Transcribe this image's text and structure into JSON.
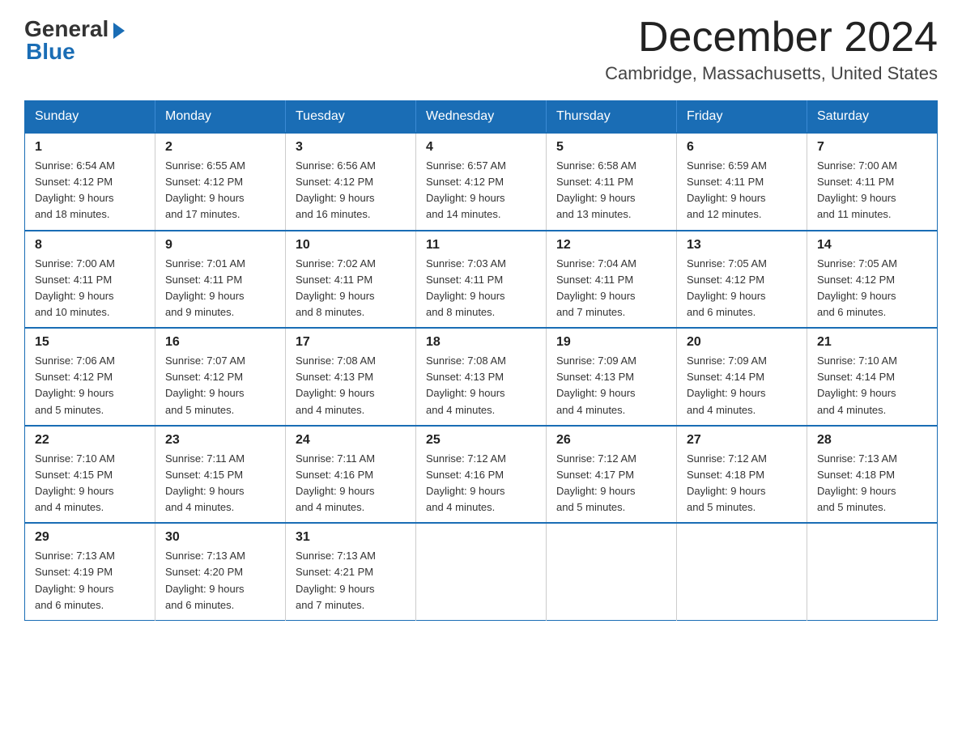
{
  "logo": {
    "general": "General",
    "blue": "Blue"
  },
  "header": {
    "month": "December 2024",
    "location": "Cambridge, Massachusetts, United States"
  },
  "weekdays": [
    "Sunday",
    "Monday",
    "Tuesday",
    "Wednesday",
    "Thursday",
    "Friday",
    "Saturday"
  ],
  "weeks": [
    [
      {
        "day": "1",
        "sunrise": "6:54 AM",
        "sunset": "4:12 PM",
        "daylight": "9 hours and 18 minutes."
      },
      {
        "day": "2",
        "sunrise": "6:55 AM",
        "sunset": "4:12 PM",
        "daylight": "9 hours and 17 minutes."
      },
      {
        "day": "3",
        "sunrise": "6:56 AM",
        "sunset": "4:12 PM",
        "daylight": "9 hours and 16 minutes."
      },
      {
        "day": "4",
        "sunrise": "6:57 AM",
        "sunset": "4:12 PM",
        "daylight": "9 hours and 14 minutes."
      },
      {
        "day": "5",
        "sunrise": "6:58 AM",
        "sunset": "4:11 PM",
        "daylight": "9 hours and 13 minutes."
      },
      {
        "day": "6",
        "sunrise": "6:59 AM",
        "sunset": "4:11 PM",
        "daylight": "9 hours and 12 minutes."
      },
      {
        "day": "7",
        "sunrise": "7:00 AM",
        "sunset": "4:11 PM",
        "daylight": "9 hours and 11 minutes."
      }
    ],
    [
      {
        "day": "8",
        "sunrise": "7:00 AM",
        "sunset": "4:11 PM",
        "daylight": "9 hours and 10 minutes."
      },
      {
        "day": "9",
        "sunrise": "7:01 AM",
        "sunset": "4:11 PM",
        "daylight": "9 hours and 9 minutes."
      },
      {
        "day": "10",
        "sunrise": "7:02 AM",
        "sunset": "4:11 PM",
        "daylight": "9 hours and 8 minutes."
      },
      {
        "day": "11",
        "sunrise": "7:03 AM",
        "sunset": "4:11 PM",
        "daylight": "9 hours and 8 minutes."
      },
      {
        "day": "12",
        "sunrise": "7:04 AM",
        "sunset": "4:11 PM",
        "daylight": "9 hours and 7 minutes."
      },
      {
        "day": "13",
        "sunrise": "7:05 AM",
        "sunset": "4:12 PM",
        "daylight": "9 hours and 6 minutes."
      },
      {
        "day": "14",
        "sunrise": "7:05 AM",
        "sunset": "4:12 PM",
        "daylight": "9 hours and 6 minutes."
      }
    ],
    [
      {
        "day": "15",
        "sunrise": "7:06 AM",
        "sunset": "4:12 PM",
        "daylight": "9 hours and 5 minutes."
      },
      {
        "day": "16",
        "sunrise": "7:07 AM",
        "sunset": "4:12 PM",
        "daylight": "9 hours and 5 minutes."
      },
      {
        "day": "17",
        "sunrise": "7:08 AM",
        "sunset": "4:13 PM",
        "daylight": "9 hours and 4 minutes."
      },
      {
        "day": "18",
        "sunrise": "7:08 AM",
        "sunset": "4:13 PM",
        "daylight": "9 hours and 4 minutes."
      },
      {
        "day": "19",
        "sunrise": "7:09 AM",
        "sunset": "4:13 PM",
        "daylight": "9 hours and 4 minutes."
      },
      {
        "day": "20",
        "sunrise": "7:09 AM",
        "sunset": "4:14 PM",
        "daylight": "9 hours and 4 minutes."
      },
      {
        "day": "21",
        "sunrise": "7:10 AM",
        "sunset": "4:14 PM",
        "daylight": "9 hours and 4 minutes."
      }
    ],
    [
      {
        "day": "22",
        "sunrise": "7:10 AM",
        "sunset": "4:15 PM",
        "daylight": "9 hours and 4 minutes."
      },
      {
        "day": "23",
        "sunrise": "7:11 AM",
        "sunset": "4:15 PM",
        "daylight": "9 hours and 4 minutes."
      },
      {
        "day": "24",
        "sunrise": "7:11 AM",
        "sunset": "4:16 PM",
        "daylight": "9 hours and 4 minutes."
      },
      {
        "day": "25",
        "sunrise": "7:12 AM",
        "sunset": "4:16 PM",
        "daylight": "9 hours and 4 minutes."
      },
      {
        "day": "26",
        "sunrise": "7:12 AM",
        "sunset": "4:17 PM",
        "daylight": "9 hours and 5 minutes."
      },
      {
        "day": "27",
        "sunrise": "7:12 AM",
        "sunset": "4:18 PM",
        "daylight": "9 hours and 5 minutes."
      },
      {
        "day": "28",
        "sunrise": "7:13 AM",
        "sunset": "4:18 PM",
        "daylight": "9 hours and 5 minutes."
      }
    ],
    [
      {
        "day": "29",
        "sunrise": "7:13 AM",
        "sunset": "4:19 PM",
        "daylight": "9 hours and 6 minutes."
      },
      {
        "day": "30",
        "sunrise": "7:13 AM",
        "sunset": "4:20 PM",
        "daylight": "9 hours and 6 minutes."
      },
      {
        "day": "31",
        "sunrise": "7:13 AM",
        "sunset": "4:21 PM",
        "daylight": "9 hours and 7 minutes."
      },
      null,
      null,
      null,
      null
    ]
  ],
  "labels": {
    "sunrise": "Sunrise:",
    "sunset": "Sunset:",
    "daylight": "Daylight:"
  }
}
